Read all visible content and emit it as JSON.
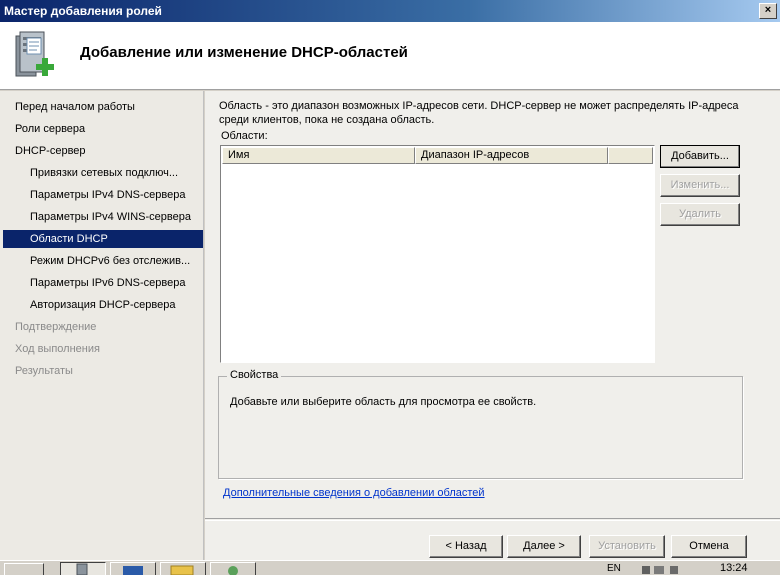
{
  "window": {
    "title": "Мастер добавления ролей",
    "close_label": "×"
  },
  "header": {
    "title": "Добавление или изменение DHCP-областей",
    "icon": "server-add-icon"
  },
  "sidebar": {
    "items": [
      {
        "label": "Перед началом работы",
        "state": "normal"
      },
      {
        "label": "Роли сервера",
        "state": "normal"
      },
      {
        "label": "DHCP-сервер",
        "state": "normal"
      },
      {
        "label": "Привязки сетевых подключ...",
        "state": "normal"
      },
      {
        "label": "Параметры IPv4 DNS-сервера",
        "state": "normal"
      },
      {
        "label": "Параметры IPv4 WINS-сервера",
        "state": "normal"
      },
      {
        "label": "Области DHCP",
        "state": "selected"
      },
      {
        "label": "Режим DHCPv6 без отслежив...",
        "state": "normal"
      },
      {
        "label": "Параметры IPv6 DNS-сервера",
        "state": "normal"
      },
      {
        "label": "Авторизация DHCP-сервера",
        "state": "normal"
      },
      {
        "label": "Подтверждение",
        "state": "disabled"
      },
      {
        "label": "Ход выполнения",
        "state": "disabled"
      },
      {
        "label": "Результаты",
        "state": "disabled"
      }
    ]
  },
  "main": {
    "intro_line1": "Область - это диапазон возможных IP-адресов сети. DHCP-сервер не может распределять IP-адреса",
    "intro_line2": "среди клиентов, пока не создана область.",
    "areas_label": "Области:",
    "columns": [
      "Имя",
      "Диапазон IP-адресов",
      ""
    ],
    "buttons": {
      "add": "Добавить...",
      "edit": "Изменить...",
      "delete": "Удалить"
    },
    "properties": {
      "title": "Свойства",
      "text": "Добавьте или выберите область для просмотра ее свойств."
    },
    "more_info_link": "Дополнительные сведения о добавлении областей"
  },
  "footer": {
    "back": "< Назад",
    "next": "Далее >",
    "install": "Установить",
    "cancel": "Отмена"
  },
  "taskbar": {
    "lang": "EN",
    "time": "13:24"
  }
}
